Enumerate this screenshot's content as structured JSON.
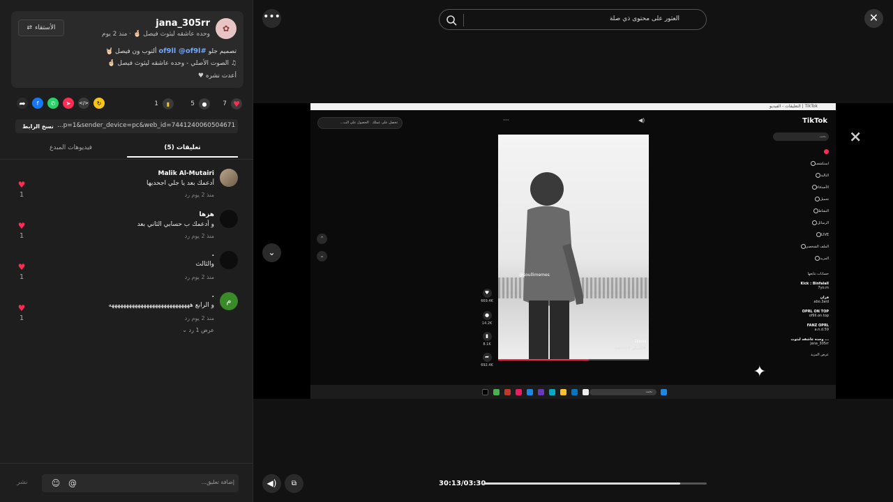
{
  "post": {
    "username": "jana_305rr",
    "subline": "وحده عاشقه ليثوث فيصل 🤞🏻 · منذ 2 يوم",
    "follow_label": "الأستقاء",
    "desc_prefix": "تصميم جلو",
    "desc_tags": "#of9ll @of9l",
    "desc_suffix": "ألتوب ون فيصل 🤘🏻",
    "music": "الصوت الأصلي - وحده عاشقه ليثوث فيصل 🤞🏻",
    "repost": "أعدت نشره"
  },
  "actions": {
    "likes": "7",
    "comments": "5",
    "saves": "1"
  },
  "link": {
    "copy_label": "نسخ الرابط",
    "url": "...p=1&sender_device=pc&web_id=7441240060504671752"
  },
  "tabs": {
    "comments": "تعليقات (5)",
    "creator_videos": "فيديوهات المبدع"
  },
  "comments": [
    {
      "name": "Malik Al-Mutairi",
      "text": "أدعمك بعد يا جلي اجحديها",
      "meta": "منذ 2 يوم    رد",
      "likes": "1"
    },
    {
      "name": "ه‍زها",
      "text": "و أدعمك ب حسابي الثاني بعد",
      "meta": "منذ 2 يوم    رد",
      "likes": "1"
    },
    {
      "name": ".",
      "text": "والثالث",
      "meta": "منذ 2 يوم    رد",
      "likes": "1"
    },
    {
      "name": ".",
      "text": "و الرابع ههههههههههههههههههههههههههههه",
      "meta": "منذ 2 يوم    رد",
      "likes": "1",
      "show_replies": "عرض 1 رد"
    }
  ],
  "comment_input": {
    "placeholder": "إضافة تعليق...",
    "post_label": "نشر"
  },
  "search": {
    "text": "العثور على محتوى ذي صلة"
  },
  "player": {
    "time": "30:13/03:30",
    "progress": 0.88
  },
  "inner": {
    "browser_title": "TikTok | التعليقات - الفيديو",
    "feed_btn1": "تحصل على عملك",
    "feed_btn2": "الحصول على الت...",
    "watermark": "@soullimemes",
    "video_user": "1bsoul",
    "video_tag": "#اكسبلور #explore",
    "logo": "TikTok",
    "side_search": "بحث",
    "rail_counts": [
      "669.4K",
      "14.2K",
      "8.1K",
      "692.4K"
    ],
    "nav": [
      "",
      "استكشف",
      "التالية",
      "الأصدقاء",
      "تحميل",
      "النشاط",
      "الرسائل",
      "LIVE",
      "الملف الشخصي",
      "المزيد"
    ],
    "following_title": "حسابات تتابعها",
    "accounts": [
      {
        "name": "Kick : Binfalall",
        "sub": "7yo.m"
      },
      {
        "name": "فزان",
        "sub": "abo.3aid"
      },
      {
        "name": "OPRL ON TOP",
        "sub": "of9ll.on.top"
      },
      {
        "name": "FANZ OPRL",
        "sub": "a.n.d.59"
      },
      {
        "name": "وحده عاشقه ليثوث ...",
        "sub": "jana_305rr"
      }
    ],
    "more_label": "عرض المزيد",
    "taskbar_search": "بحث"
  }
}
